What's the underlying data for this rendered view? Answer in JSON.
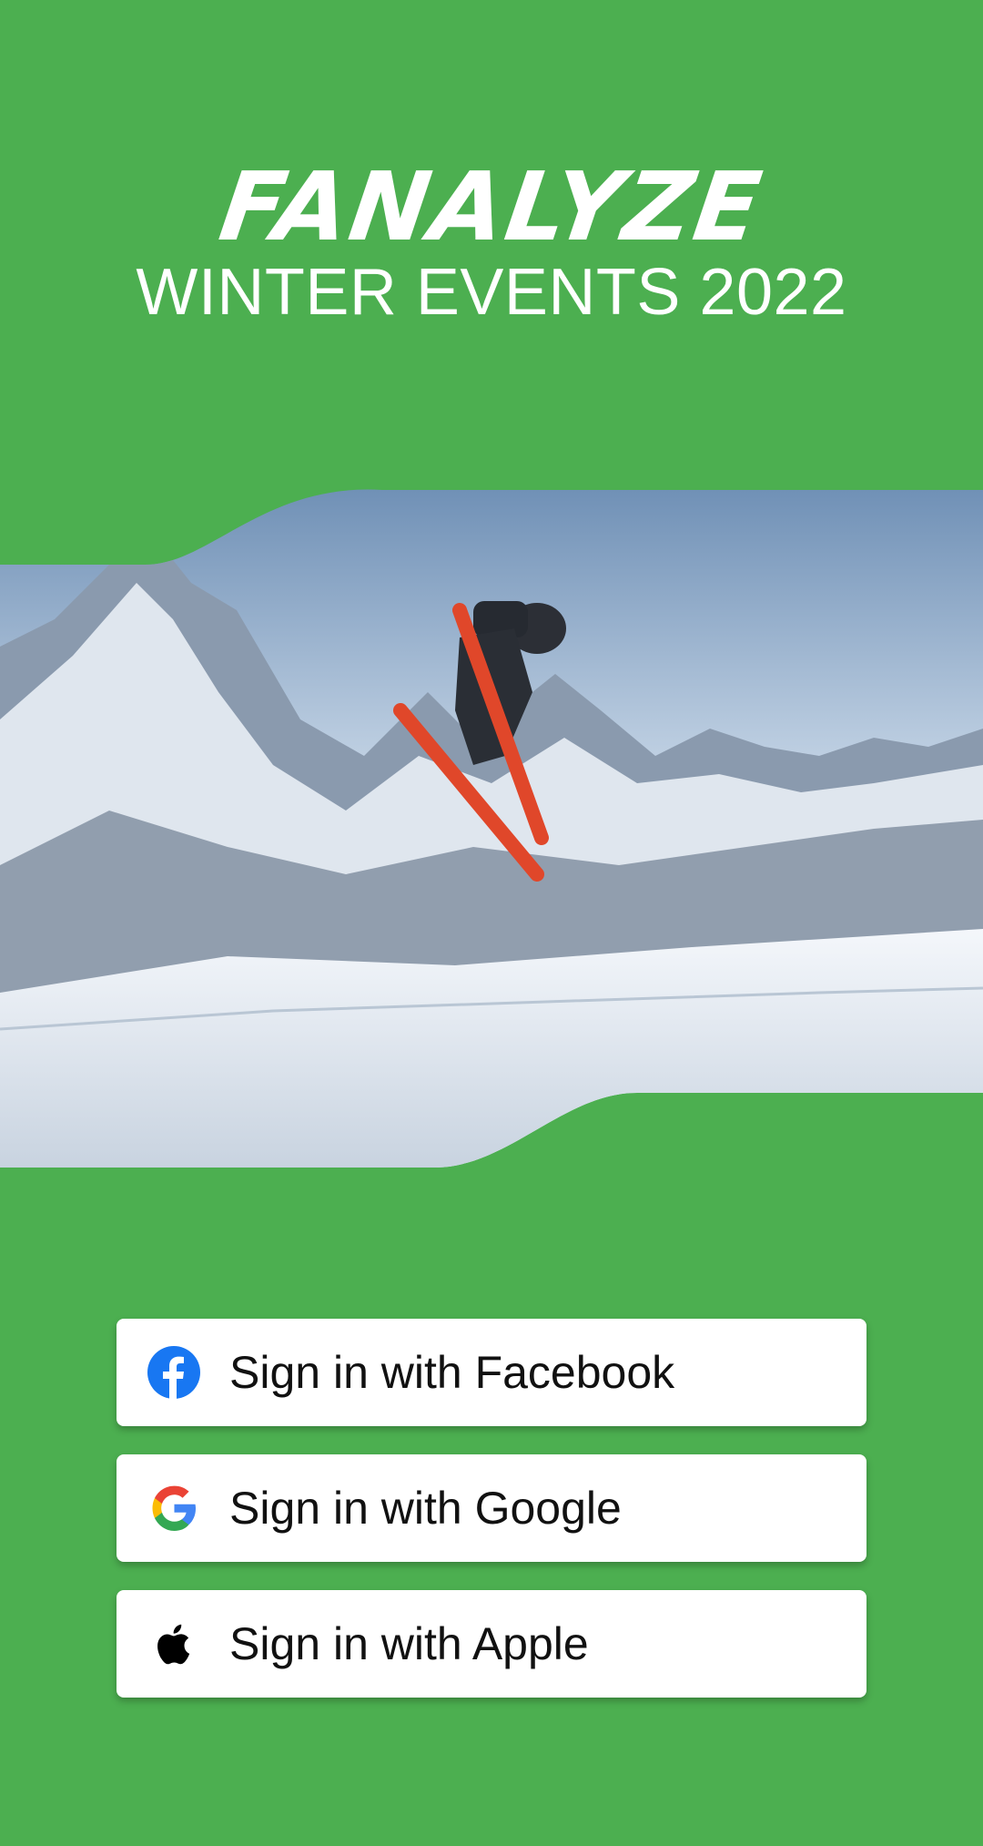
{
  "header": {
    "brand": "FANALYZE",
    "subtitle": "WINTER EVENTS 2022"
  },
  "hero": {
    "image_description_icon": "ski-jump-photo"
  },
  "signin": {
    "facebook_label": "Sign in with Facebook",
    "google_label": "Sign in with Google",
    "apple_label": "Sign in with Apple"
  },
  "colors": {
    "background": "#4caf50",
    "button_bg": "#ffffff",
    "facebook": "#1877f2"
  }
}
